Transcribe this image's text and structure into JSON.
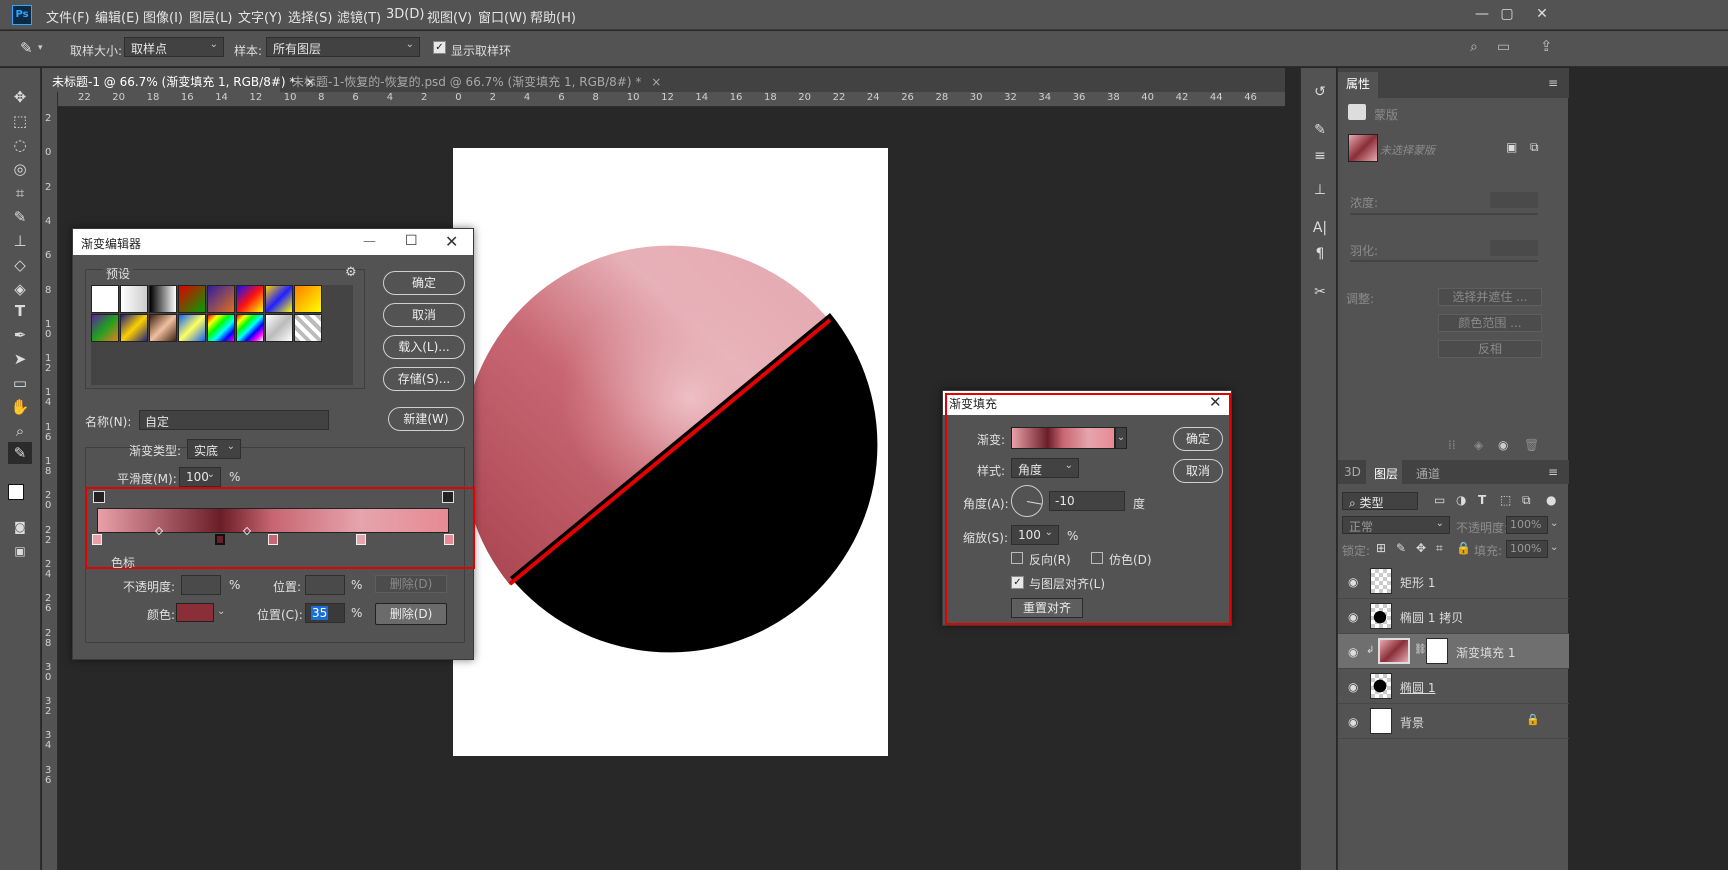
{
  "app": {
    "logo": "Ps"
  },
  "menu": [
    "文件(F)",
    "编辑(E)",
    "图像(I)",
    "图层(L)",
    "文字(Y)",
    "选择(S)",
    "滤镜(T)",
    "3D(D)",
    "视图(V)",
    "窗口(W)",
    "帮助(H)"
  ],
  "window_controls": {
    "minimize": "—",
    "restore": "▢",
    "close": "✕"
  },
  "options": {
    "sample_size_label": "取样大小:",
    "sample_size_value": "取样点",
    "sample_label": "样本:",
    "sample_value": "所有图层",
    "show_ring_label": "显示取样环",
    "show_ring_checked": true
  },
  "doc_tabs": [
    {
      "label": "未标题-1 @ 66.7% (渐变填充 1, RGB/8#) *",
      "close": "×",
      "active": true
    },
    {
      "label": "未标题-1-恢复的-恢复的.psd @ 66.7% (渐变填充 1, RGB/8#) *",
      "close": "×",
      "active": false
    }
  ],
  "ruler_h": [
    "22",
    "20",
    "18",
    "16",
    "14",
    "12",
    "10",
    "8",
    "6",
    "4",
    "2",
    "0",
    "2",
    "4",
    "6",
    "8",
    "10",
    "12",
    "14",
    "16",
    "18",
    "20",
    "22",
    "24",
    "26",
    "28",
    "30",
    "32",
    "34",
    "36",
    "38",
    "40",
    "42",
    "44",
    "46"
  ],
  "ruler_v": [
    "2",
    "0",
    "2",
    "4",
    "6",
    "8",
    "1 0",
    "1 2",
    "1 4",
    "1 6",
    "1 8",
    "2 0",
    "2 2",
    "2 4",
    "2 6",
    "2 8",
    "3 0",
    "3 2",
    "3 4",
    "3 6"
  ],
  "gradient_editor": {
    "title": "渐变编辑器",
    "presets_label": "预设",
    "ok": "确定",
    "cancel": "取消",
    "load": "载入(L)...",
    "save": "存储(S)...",
    "name_label": "名称(N):",
    "name_value": "自定",
    "new_button": "新建(W)",
    "type_label": "渐变类型:",
    "type_value": "实底",
    "smooth_label": "平滑度(M):",
    "smooth_value": "100",
    "percent": "%",
    "stops_label": "色标",
    "opacity_label": "不透明度:",
    "position_label": "位置:",
    "delete_label": "删除(D)",
    "color_label": "颜色:",
    "color_value": "#8a2e38",
    "position_c_label": "位置(C):",
    "position_c_value": "35",
    "delete_button": "删除(D)",
    "stops": [
      {
        "position": 0,
        "color": "#e9a0a8"
      },
      {
        "position": 35,
        "color": "#6b1e28"
      },
      {
        "position": 50,
        "color": "#c86672"
      },
      {
        "position": 75,
        "color": "#e6a4ac"
      },
      {
        "position": 100,
        "color": "#e78a94"
      }
    ]
  },
  "gradient_fill": {
    "title": "渐变填充",
    "gradient_label": "渐变:",
    "style_label": "样式:",
    "style_value": "角度",
    "angle_label": "角度(A):",
    "angle_value": "-10",
    "angle_unit": "度",
    "scale_label": "缩放(S):",
    "scale_value": "100",
    "percent": "%",
    "reverse_label": "反向(R)",
    "reverse_checked": false,
    "dither_label": "仿色(D)",
    "dither_checked": false,
    "align_label": "与图层对齐(L)",
    "align_checked": true,
    "reset_button": "重置对齐",
    "ok": "确定",
    "cancel": "取消"
  },
  "properties": {
    "tab": "属性",
    "mask_label": "蒙版",
    "no_mask": "未选择蒙版",
    "density_label": "浓度:",
    "feather_label": "羽化:",
    "refine_label": "调整:",
    "select_and_mask": "选择并遮住 ...",
    "color_range": "颜色范围 ...",
    "invert": "反相"
  },
  "layers_panel": {
    "tabs": [
      "3D",
      "图层",
      "通道"
    ],
    "active_tab": "图层",
    "filter_label": "类型",
    "blend_mode": "正常",
    "opacity_label": "不透明度:",
    "opacity_value": "100%",
    "lock_label": "锁定:",
    "fill_label": "填充:",
    "fill_value": "100%",
    "layers": [
      {
        "name": "矩形 1",
        "selected": false
      },
      {
        "name": "椭圆 1 拷贝",
        "selected": false
      },
      {
        "name": "渐变填充 1",
        "selected": true
      },
      {
        "name": "椭圆 1",
        "selected": false
      },
      {
        "name": "背景",
        "selected": false
      }
    ]
  },
  "colors": {
    "accent_red": "#e20000",
    "gradient_light": "#e8a9b0",
    "gradient_dark": "#6b1e28",
    "canvas_bg": "#282828",
    "panel_bg": "#535353"
  }
}
